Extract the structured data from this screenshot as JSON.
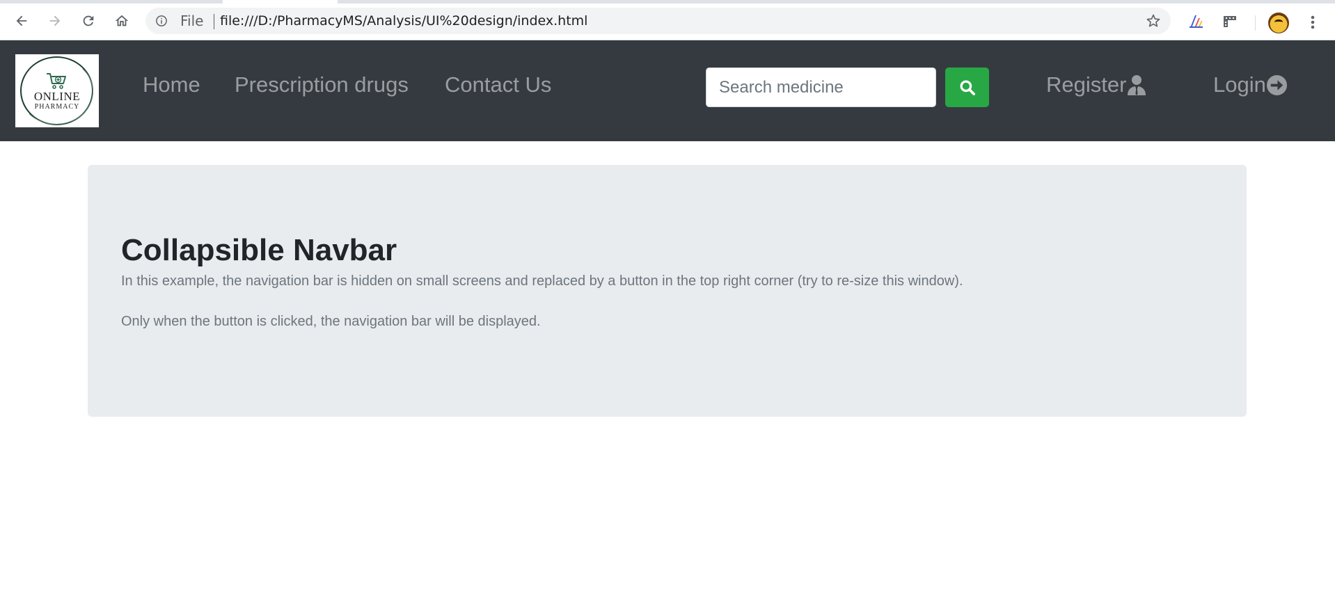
{
  "browser": {
    "omnibox": {
      "scheme_label": "File",
      "url": "file:///D:/PharmacyMS/Analysis/UI%20design/index.html"
    },
    "icons": {
      "back": "arrow-left-icon",
      "forward": "arrow-right-icon",
      "reload": "reload-icon",
      "home": "home-icon",
      "info": "info-icon",
      "bookmark": "star-icon",
      "extension_1": "extension-icon",
      "extension_2": "ruler-extension-icon",
      "profile": "avatar",
      "menu": "more-vert-icon"
    }
  },
  "navbar": {
    "logo": {
      "line1": "ONLINE",
      "line2": "PHARMACY"
    },
    "links": [
      {
        "label": "Home"
      },
      {
        "label": "Prescription drugs"
      },
      {
        "label": "Contact Us"
      }
    ],
    "search": {
      "placeholder": "Search medicine",
      "value": "",
      "button_icon": "search-icon"
    },
    "register_label": "Register",
    "register_icon": "user-icon",
    "login_label": "Login",
    "login_icon": "arrow-circle-right-icon",
    "colors": {
      "background": "#343a40",
      "search_button": "#28a745"
    }
  },
  "jumbotron": {
    "title": "Collapsible Navbar",
    "paragraph1": "In this example, the navigation bar is hidden on small screens and replaced by a button in the top right corner (try to re-size this window).",
    "paragraph2": "Only when the button is clicked, the navigation bar will be displayed.",
    "colors": {
      "background": "#e9ecef",
      "title": "#212529",
      "text": "#6c757d"
    }
  }
}
